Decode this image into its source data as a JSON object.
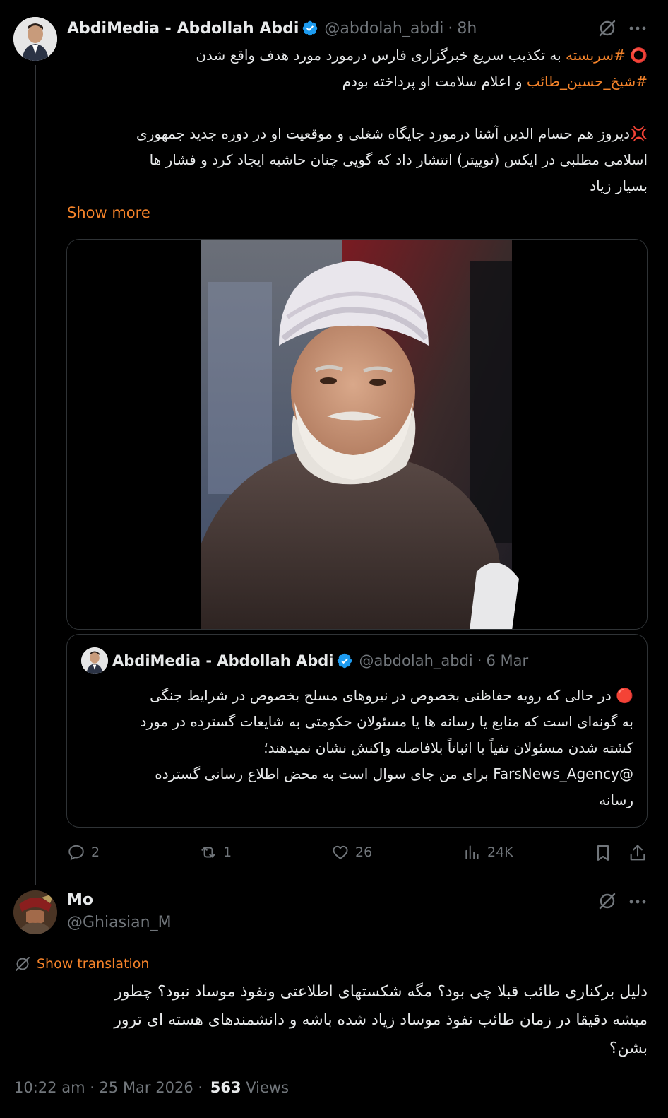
{
  "main_tweet": {
    "author_name": "AbdiMedia - Abdollah Abdi",
    "handle": "@abdolah_abdi",
    "time_sep": "·",
    "time": "8h",
    "line1_emoji": "⭕",
    "line1_tag": "#سربسته",
    "line1_text": "به تکذیب سریع خبرگزاری فارس درمورد مورد هدف واقع شدن",
    "line2_tag": "#شیخ_حسین_طائب",
    "line2_text": "و اعلام سلامت او پرداخته بودم",
    "para2_emoji": "💢",
    "para2_line1": "دیروز هم حسام الدین آشنا درمورد جایگاه شغلی و موقعیت او در دوره جدید جمهوری",
    "para2_line2": "اسلامی مطلبی در ایکس (توییتر) انتشار داد که گویی چنان حاشیه ایجاد کرد و فشار ها",
    "para2_line3": "بسیار زیاد",
    "show_more": "Show more",
    "more_icon": "ellipsis-icon",
    "grok_icon": "grok-icon"
  },
  "quoted_tweet": {
    "author_name": "AbdiMedia - Abdollah Abdi",
    "handle": "@abdolah_abdi",
    "time_sep": "·",
    "time": "6 Mar",
    "emoji": "🔴",
    "line1": "در حالی که رویه حفاظتی بخصوص در نیروهای مسلح بخصوص در شرایط جنگی",
    "line2": "به گونه‌ای است که منابع یا رسانه ها یا مسئولان حکومتی به شایعات گسترده در مورد",
    "line3": "کشته شدن مسئولان نفیاً یا اثباتاً بلافاصله واکنش نشان نمیدهند؛",
    "line4_mention": "@FarsNews_Agency",
    "line4_text": "برای من جای سوال است به محض اطلاع رسانی گسترده",
    "line5": "رسانه"
  },
  "actions": {
    "replies": "2",
    "reposts": "1",
    "likes": "26",
    "views": "24K"
  },
  "reply_tweet": {
    "author_name": "Mo",
    "handle": "@Ghiasian_M",
    "show_translation": "Show translation",
    "line1": "دلیل برکناری طائب قبلا چی بود؟ مگه شکستهای اطلاعتی ونفوذ موساد نبود؟ چطور",
    "line2": "میشه دقیقا در زمان طائب نفوذ موساد زیاد شده باشه و دانشمندهای هسته ای ترور",
    "line3": "بشن؟",
    "timestamp": "10:22 am · 25 Mar 2026 ·",
    "views_count": "563",
    "views_label": "Views"
  },
  "colors": {
    "accent": "#f4832a",
    "verified": "#1d9bf0",
    "muted": "#71767b",
    "border": "#2f3336"
  }
}
